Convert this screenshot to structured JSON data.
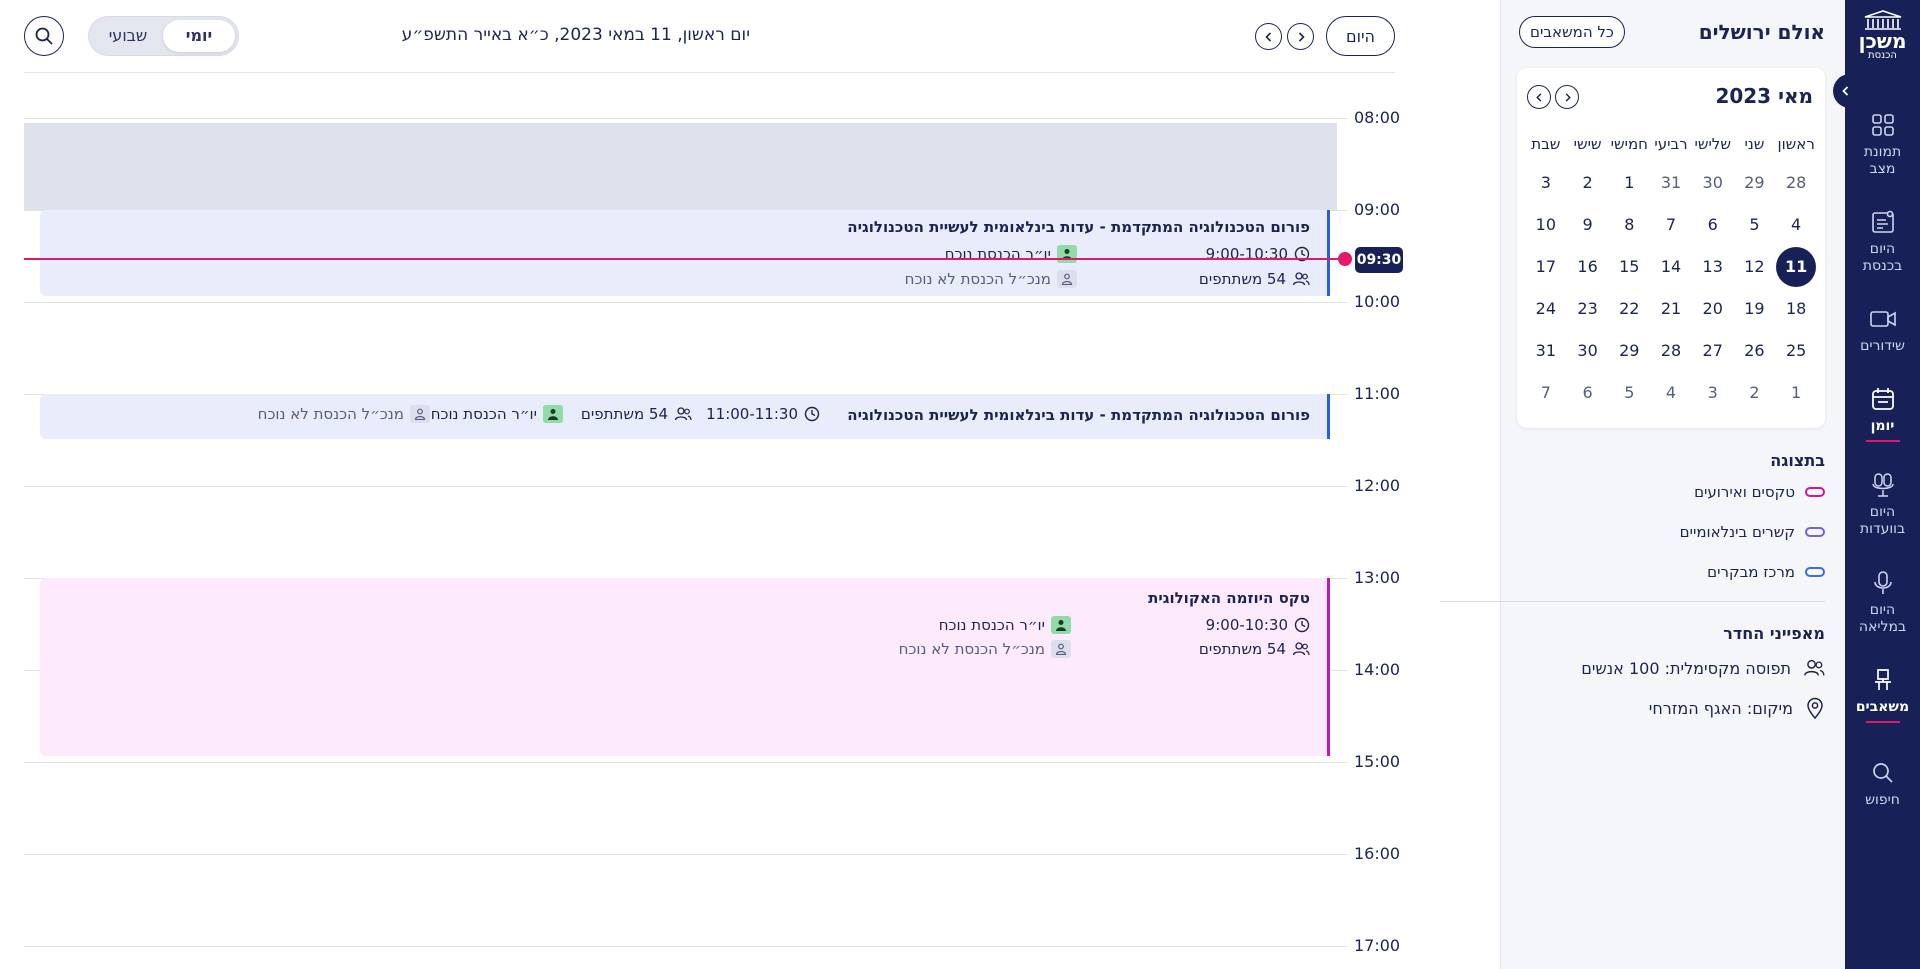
{
  "app": {
    "logo_main": "משכן",
    "logo_sub": "הכנסת"
  },
  "nav": {
    "items": [
      {
        "label": "תמונת\nמצב",
        "icon": "grid-icon"
      },
      {
        "label": "היום\nבכנסת",
        "icon": "notes-icon"
      },
      {
        "label": "שידורים",
        "icon": "video-icon"
      },
      {
        "label": "יומן",
        "icon": "calendar-icon"
      },
      {
        "label": "היום\nבוועדות",
        "icon": "microphones-icon"
      },
      {
        "label": "היום\nבמליאה",
        "icon": "microphone-icon"
      },
      {
        "label": "משאבים",
        "icon": "chair-icon"
      },
      {
        "label": "חיפוש",
        "icon": "search-icon"
      }
    ],
    "active": "יומן"
  },
  "panel": {
    "title": "אולם ירושלים",
    "all_resources_button": "כל המשאבים",
    "calendar": {
      "month_label": "מאי 2023",
      "weekdays": [
        "ראשון",
        "שני",
        "שלישי",
        "רביעי",
        "חמישי",
        "שישי",
        "שבת"
      ],
      "weeks": [
        [
          "28",
          "29",
          "30",
          "31",
          "1",
          "2",
          "3"
        ],
        [
          "4",
          "5",
          "6",
          "7",
          "8",
          "9",
          "10"
        ],
        [
          "11",
          "12",
          "13",
          "14",
          "15",
          "16",
          "17"
        ],
        [
          "18",
          "19",
          "20",
          "21",
          "22",
          "23",
          "24"
        ],
        [
          "25",
          "26",
          "27",
          "28",
          "29",
          "30",
          "31"
        ],
        [
          "1",
          "2",
          "3",
          "4",
          "5",
          "6",
          "7"
        ]
      ],
      "selected_day": "11"
    },
    "display": {
      "title": "בתצוגה",
      "items": [
        {
          "label": "טקסים ואירועים",
          "color": "#d0198f"
        },
        {
          "label": "קשרים בינלאומיים",
          "color": "#7a5ce6"
        },
        {
          "label": "מרכז מבקרים",
          "color": "#3b6fe0"
        }
      ]
    },
    "features": {
      "title": "מאפייני החדר",
      "capacity": "תפוסה מקסימלית: 100 אנשים",
      "location": "מיקום: האגף המזרחי"
    }
  },
  "header": {
    "today_button": "היום",
    "date_title": "יום ראשון, 11 במאי 2023, כ״א באייר התשפ״ע",
    "views": {
      "daily": "יומי",
      "weekly": "שבועי"
    },
    "active_view": "daily"
  },
  "schedule": {
    "hours": [
      "08:00",
      "09:00",
      "10:00",
      "11:00",
      "12:00",
      "13:00",
      "14:00",
      "15:00",
      "16:00",
      "17:00"
    ],
    "current_time": "09:30",
    "events": [
      {
        "title": "פורום הטכנולוגיה המתקדמת - עדות בינלאומית לעשיית הטכנולוגיה",
        "time": "9:00-10:30",
        "participants": "54 משתתפים",
        "chair_status": "יו״ר הכנסת נוכח",
        "dg_status": "מנכ״ל הכנסת לא נוכח"
      },
      {
        "title": "פורום הטכנולוגיה המתקדמת - עדות בינלאומית לעשיית הטכנולוגיה",
        "time": "11:00-11:30",
        "participants": "54 משתתפים",
        "chair_status": "יו״ר הכנסת נוכח",
        "dg_status": "מנכ״ל הכנסת לא נוכח"
      },
      {
        "title": "טקס היוזמה האקולוגית",
        "time": "9:00-10:30",
        "participants": "54 משתתפים",
        "chair_status": "יו״ר הכנסת נוכח",
        "dg_status": "מנכ״ל הכנסת לא נוכח"
      }
    ]
  },
  "colors": {
    "navy": "#172158",
    "accent_red": "#e2186a",
    "event_blue_bg": "#e9ecfb",
    "event_pink_bg": "#fdeafc",
    "blocked_bg": "#dfe1ec"
  }
}
